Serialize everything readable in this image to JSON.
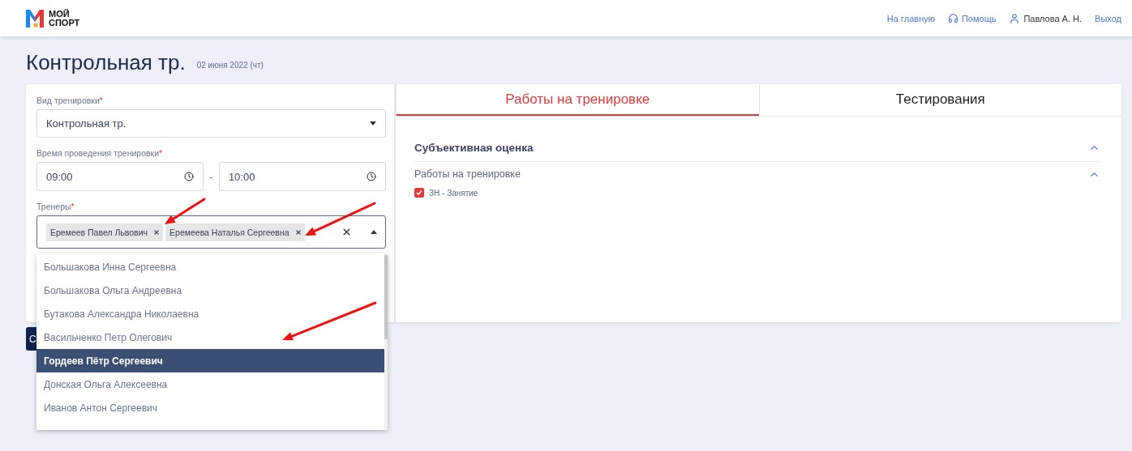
{
  "logo": {
    "line1": "МОЙ",
    "line2": "СПОРТ"
  },
  "nav": [
    {
      "kind": "link",
      "label": "На главную"
    },
    {
      "kind": "help",
      "label": "Помощь"
    },
    {
      "kind": "user",
      "label": "Павлова А. Н."
    },
    {
      "kind": "link",
      "label": "Выход"
    }
  ],
  "page": {
    "title": "Контрольная тр.",
    "date": "02 июня 2022 (чт)"
  },
  "form": {
    "training_type": {
      "label": "Вид тренировки",
      "required_mark": "*",
      "value": "Контрольная тр."
    },
    "time": {
      "label": "Время проведения тренировки",
      "required_mark": "*",
      "start": "09:00",
      "separator": "-",
      "end": "10:00"
    },
    "coaches": {
      "label": "Тренеры",
      "required_mark": "*",
      "chips": [
        "Еремеев Павел Львович",
        "Еремеева Наталья Сергеевна"
      ],
      "open": true,
      "options": [
        {
          "name": "Большакова Инна Сергеевна",
          "selected": false
        },
        {
          "name": "Большакова Ольга Андреевна",
          "selected": false
        },
        {
          "name": "Бутакова Александра Николаевна",
          "selected": false
        },
        {
          "name": "Васильченко Петр Олегович",
          "selected": false
        },
        {
          "name": "Гордеев Пётр Сергеевич",
          "selected": true
        },
        {
          "name": "Донская Ольга Алексеевна",
          "selected": false
        },
        {
          "name": "Иванов Антон Сергеевич",
          "selected": false
        }
      ]
    },
    "save_button": {
      "label": "С"
    }
  },
  "tabs": [
    {
      "label": "Работы на тренировке",
      "selected": true
    },
    {
      "label": "Тестирования",
      "selected": false
    }
  ],
  "sections": [
    {
      "kind": "header",
      "title": "Субъективная оценка",
      "expanded": true
    },
    {
      "kind": "checklist",
      "title": "Работы на тренировке",
      "expanded": true,
      "items": [
        {
          "label": "ЗН - Занятие",
          "checked": true
        }
      ]
    }
  ]
}
